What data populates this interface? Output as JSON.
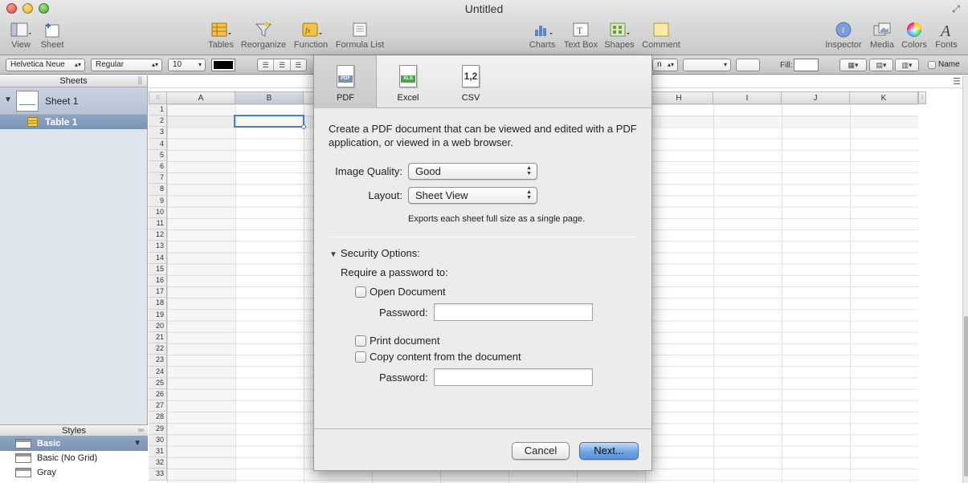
{
  "window": {
    "title": "Untitled"
  },
  "toolbar": {
    "view": "View",
    "sheet": "Sheet",
    "tables": "Tables",
    "reorganize": "Reorganize",
    "function": "Function",
    "formula_list": "Formula List",
    "charts": "Charts",
    "text_box": "Text Box",
    "shapes": "Shapes",
    "comment": "Comment",
    "inspector": "Inspector",
    "media": "Media",
    "colors": "Colors",
    "fonts": "Fonts"
  },
  "format_bar": {
    "font_family": "Helvetica Neue",
    "font_style": "Regular",
    "font_size": "10",
    "fill_label": "Fill:",
    "name_label": "Name",
    "partial_select": "n"
  },
  "sidebar": {
    "sheets_header": "Sheets",
    "sheet_name": "Sheet 1",
    "table_name": "Table 1",
    "styles_header": "Styles",
    "styles": [
      "Basic",
      "Basic (No Grid)",
      "Gray"
    ]
  },
  "spreadsheet": {
    "columns": [
      "A",
      "B",
      "H",
      "I",
      "J",
      "K"
    ],
    "rows": [
      "1",
      "2",
      "3",
      "4",
      "5",
      "6",
      "7",
      "8",
      "9",
      "10",
      "11",
      "12",
      "13",
      "14",
      "15",
      "16",
      "17",
      "18",
      "19",
      "20",
      "21",
      "22",
      "23",
      "24",
      "25",
      "26",
      "27",
      "28",
      "29",
      "30",
      "31",
      "32",
      "33"
    ]
  },
  "export_dialog": {
    "tabs": [
      {
        "label": "PDF",
        "icon_text": "PDF"
      },
      {
        "label": "Excel",
        "icon_text": "XLS"
      },
      {
        "label": "CSV",
        "icon_text": "1,2"
      }
    ],
    "description": "Create a PDF document that can be viewed and edited with a PDF application, or viewed in a web browser.",
    "image_quality_label": "Image Quality:",
    "image_quality_value": "Good",
    "layout_label": "Layout:",
    "layout_value": "Sheet View",
    "layout_note": "Exports each sheet full size as a single page.",
    "security_title": "Security Options:",
    "require_label": "Require a password to:",
    "open_document": "Open Document",
    "password_label": "Password:",
    "print_document": "Print document",
    "copy_content": "Copy content from the document",
    "cancel_button": "Cancel",
    "next_button": "Next..."
  }
}
